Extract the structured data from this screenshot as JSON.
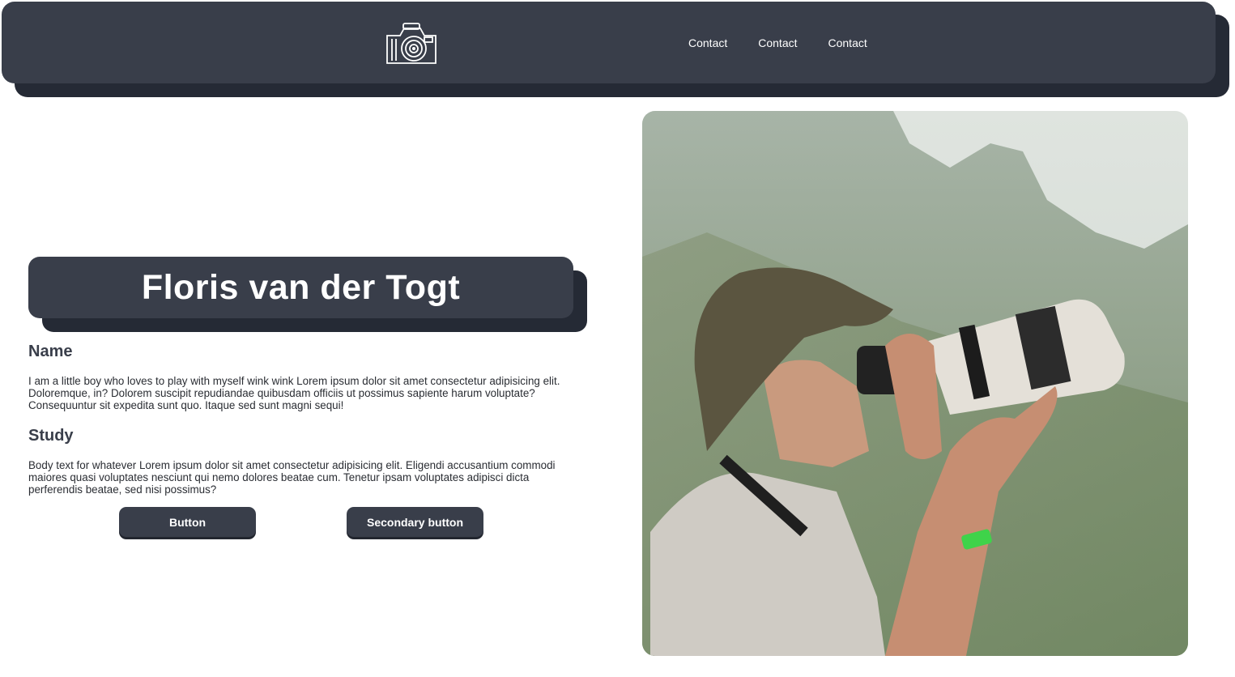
{
  "header": {
    "logo_alt": "camera logo",
    "nav_links": [
      "Contact",
      "Contact",
      "Contact"
    ]
  },
  "hero": {
    "title": "Floris van der Togt"
  },
  "sections": {
    "name": {
      "heading": "Name",
      "body": "I am a little boy who loves to play with myself wink wink Lorem ipsum dolor sit amet consectetur adipisicing elit. Doloremque, in? Dolorem suscipit repudiandae quibusdam officiis ut possimus sapiente harum voluptate? Consequuntur sit expedita sunt quo. Itaque sed sunt magni sequi!"
    },
    "study": {
      "heading": "Study",
      "body": "Body text for whatever Lorem ipsum dolor sit amet consectetur adipisicing elit. Eligendi accusantium commodi maiores quasi voluptates nesciunt qui nemo dolores beatae cum. Tenetur ipsam voluptates adipisci dicta perferendis beatae, sed nisi possimus?"
    }
  },
  "buttons": {
    "primary_label": "Button",
    "secondary_label": "Secondary button"
  },
  "photo": {
    "subject": "photographer with telephoto lens camera"
  },
  "colors": {
    "nav_bg": "#393e4a",
    "nav_shadow": "#252a35",
    "text_dark": "#393e4a"
  }
}
